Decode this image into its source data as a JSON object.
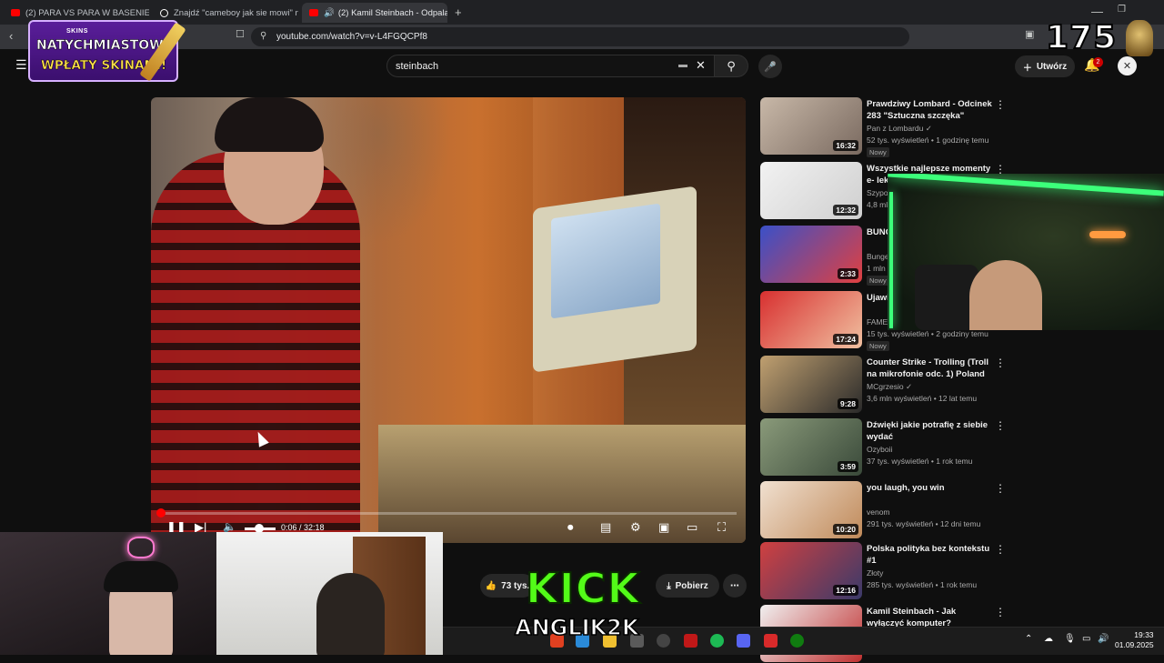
{
  "browser": {
    "tabs": [
      {
        "label": "(2) PARA VS PARA W BASENIE - YouT"
      },
      {
        "label": "Znajdź \"cameboy jak sie mowi\" na Ti"
      },
      {
        "label": "(2) Kamil Steinbach - Odpala"
      }
    ],
    "url": "youtube.com/watch?v=v-L4FGQCPf8"
  },
  "youtube": {
    "search_value": "steinbach",
    "create_label": "Utwórz",
    "notifications_count": "2",
    "player": {
      "timecode": "0:06 / 32:18",
      "progress": 0.003
    },
    "actions": {
      "likes_label": "73 tys.",
      "download_label": "Pobierz",
      "more_label": "⋯"
    },
    "recommendations": [
      {
        "title": "Prawdziwy Lombard - Odcinek 283 \"Sztuczna szczęka\"",
        "channel": "Pan z Lombardu ✓",
        "meta": "52 tys. wyświetleń • 1 godzinę temu",
        "badge": "Nowy",
        "duration": "16:32"
      },
      {
        "title": "Wszystkie najlepsze momenty e- lek",
        "channel": "Szypo",
        "meta": "4,8 mln",
        "badge": "",
        "duration": "12:32"
      },
      {
        "title": "BUNG Video",
        "channel": "Bunge",
        "meta": "1 mln",
        "badge": "Nowy",
        "duration": "2:33"
      },
      {
        "title": "Ujawi Dajcz",
        "channel": "FAME",
        "meta": "15 tys. wyświetleń • 2 godziny temu",
        "badge": "Nowy",
        "duration": "17:24"
      },
      {
        "title": "Counter Strike - Trolling (Troll na mikrofonie odc. 1) Poland /...",
        "channel": "MCgrzesio ✓",
        "meta": "3,6 mln wyświetleń • 12 lat temu",
        "badge": "",
        "duration": "9:28"
      },
      {
        "title": "Dźwięki jakie potrafię z siebie wydać",
        "channel": "Ozyboii",
        "meta": "37 tys. wyświetleń • 1 rok temu",
        "badge": "",
        "duration": "3:59"
      },
      {
        "title": "you laugh, you win",
        "channel": "venom",
        "meta": "291 tys. wyświetleń • 12 dni temu",
        "badge": "",
        "duration": "10:20"
      },
      {
        "title": "Polska polityka bez kontekstu #1",
        "channel": "Złoty",
        "meta": "285 tys. wyświetleń • 1 rok temu",
        "badge": "",
        "duration": "12:16"
      },
      {
        "title": "Kamil Steinbach - Jak wyłączyć komputer?",
        "channel": "",
        "meta": "",
        "badge": "",
        "duration": ""
      }
    ]
  },
  "overlays": {
    "ad_brand": "SKINS",
    "ad_line1": "NATYCHMIASTOWE",
    "ad_line2": "WPŁATY SKINAMI!",
    "counter": "175",
    "kick_logo": "KICK",
    "kick_user": "ANGLIK2K"
  },
  "taskbar": {
    "time": "19:33",
    "date": "01.09.2025"
  },
  "icons": [
    "back-icon",
    "reload-icon",
    "bookmark-icon",
    "menu-icon",
    "search-icon",
    "mic-icon",
    "bell-icon",
    "pause-icon",
    "next-icon",
    "volume-icon",
    "settings-icon",
    "miniplayer-icon",
    "theater-icon",
    "fullscreen-icon",
    "like-icon",
    "download-icon"
  ]
}
